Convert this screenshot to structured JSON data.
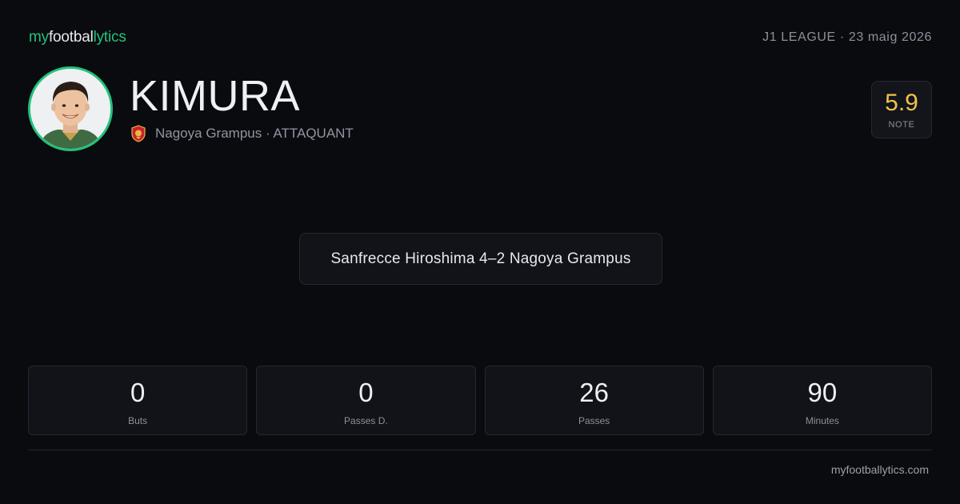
{
  "brand": {
    "part1": "my",
    "part2": "footbal",
    "part3": "lytics"
  },
  "header": {
    "league_date": "J1 LEAGUE · 23 maig 2026"
  },
  "player": {
    "name": "KIMURA",
    "team_position": "Nagoya Grampus · ATTAQUANT",
    "rating": "5.9",
    "rating_label": "NOTE"
  },
  "match": {
    "summary": "Sanfrecce Hiroshima 4–2 Nagoya Grampus"
  },
  "stats": [
    {
      "value": "0",
      "label": "Buts"
    },
    {
      "value": "0",
      "label": "Passes D."
    },
    {
      "value": "26",
      "label": "Passes"
    },
    {
      "value": "90",
      "label": "Minutes"
    }
  ],
  "footer": {
    "site": "myfootballytics.com"
  },
  "colors": {
    "accent": "#22c27a",
    "rating": "#f2c14e",
    "background": "#0a0b0f"
  },
  "icons": {
    "team_crest": "nagoya-grampus-crest-icon"
  }
}
